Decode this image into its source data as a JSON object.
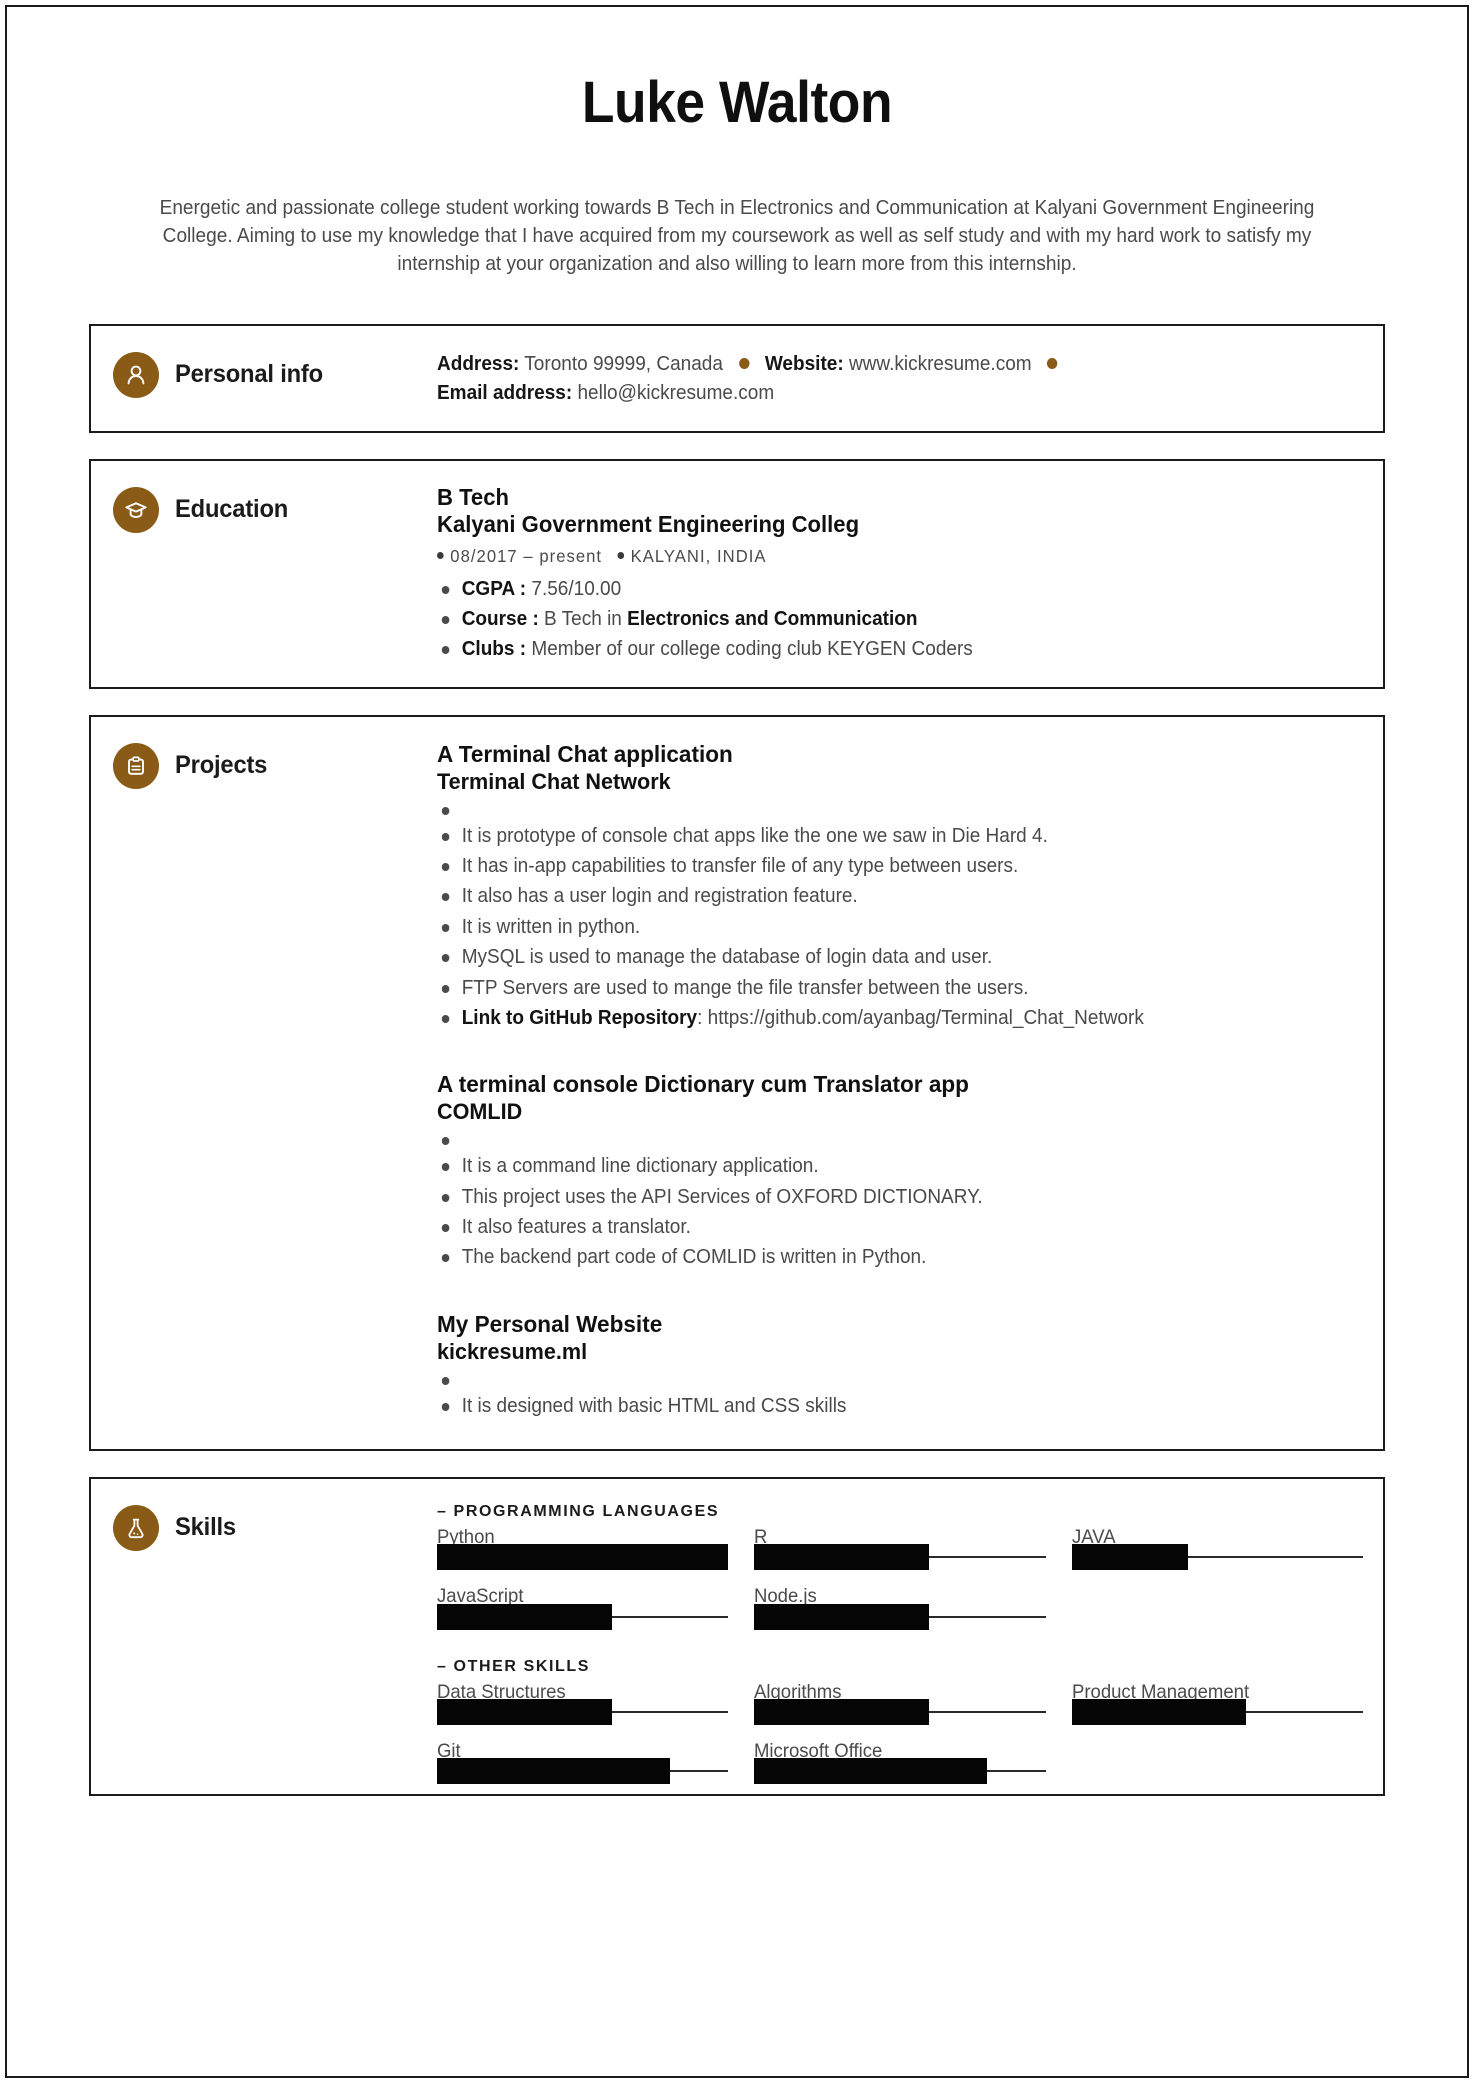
{
  "header": {
    "name": "Luke Walton",
    "summary": "Energetic and passionate college student working towards B Tech in Electronics and Communication at Kalyani Government Engineering College. Aiming to use my knowledge that I have acquired from my coursework as well as self study and with my hard work to satisfy my internship at your organization and also willing to learn more from this internship."
  },
  "colors": {
    "accent_brown": "#8a5a17",
    "text_dark": "#1b1b1b",
    "text_body": "#4a4a4a",
    "bar_fill": "#050505",
    "border": "#1b1b1b"
  },
  "personal_info": {
    "section_title": "Personal info",
    "icon": "person-icon",
    "address_label": "Address:",
    "address_value": "Toronto 99999, Canada",
    "website_label": "Website:",
    "website_value": "www.kickresume.com",
    "email_label": "Email address:",
    "email_value": "hello@kickresume.com"
  },
  "education": {
    "section_title": "Education",
    "icon": "graduation-cap-icon",
    "degree": "B Tech",
    "school": "Kalyani Government Engineering Colleg",
    "dates": "08/2017 – present",
    "location": "KALYANI, INDIA",
    "details": [
      {
        "label": "CGPA :",
        "value": " 7.56/10.00",
        "bold_tail": ""
      },
      {
        "label": "Course :",
        "value": " B Tech in ",
        "bold_tail": "Electronics and Communication"
      },
      {
        "label": "Clubs :",
        "value": " Member of our college coding club KEYGEN Coders",
        "bold_tail": ""
      }
    ]
  },
  "projects": {
    "section_title": "Projects",
    "icon": "clipboard-icon",
    "items": [
      {
        "title": "A Terminal Chat application",
        "subtitle": "Terminal Chat Network",
        "bullets": [
          "",
          "It is prototype of console chat apps like the one we saw in Die Hard 4.",
          "It has in-app capabilities to transfer file of any type between users.",
          "It also has a user login and registration feature.",
          "It is written in python.",
          "MySQL is used to manage the database of login data and user.",
          "FTP Servers are used to mange the file transfer between the users."
        ],
        "link_label": "Link to GitHub Repository",
        "link_value": ": https://github.com/ayanbag/Terminal_Chat_Network"
      },
      {
        "title": "A terminal console Dictionary cum Translator app",
        "subtitle": "COMLID",
        "bullets": [
          "",
          "It is a command line dictionary application.",
          "This project uses the API Services of OXFORD DICTIONARY.",
          "It also features a translator.",
          "The backend part code of COMLID is written in Python."
        ],
        "link_label": "",
        "link_value": ""
      },
      {
        "title": "My Personal Website",
        "subtitle": "kickresume.ml",
        "bullets": [
          "",
          "It is designed with basic HTML and CSS skills"
        ],
        "link_label": "",
        "link_value": ""
      }
    ]
  },
  "skills": {
    "section_title": "Skills",
    "icon": "flask-icon",
    "groups": [
      {
        "title": "– PROGRAMMING LANGUAGES",
        "items": [
          {
            "name": "Python",
            "level": 100
          },
          {
            "name": "R",
            "level": 60
          },
          {
            "name": "JAVA",
            "level": 40
          },
          {
            "name": "JavaScript",
            "level": 60
          },
          {
            "name": "Node.js",
            "level": 60
          }
        ]
      },
      {
        "title": "– OTHER SKILLS",
        "items": [
          {
            "name": "Data Structures",
            "level": 60
          },
          {
            "name": "Algorithms",
            "level": 60
          },
          {
            "name": "Product Management",
            "level": 60
          },
          {
            "name": "Git",
            "level": 80
          },
          {
            "name": "Microsoft Office",
            "level": 80
          }
        ]
      }
    ]
  }
}
